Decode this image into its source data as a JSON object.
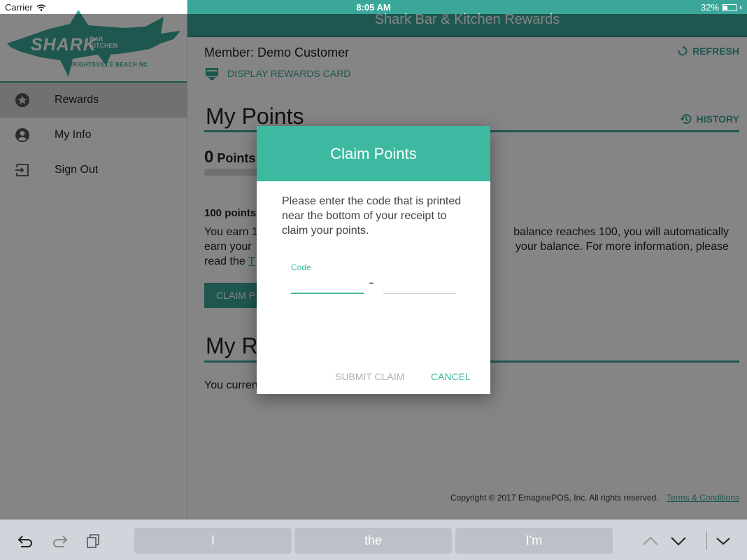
{
  "status_bar": {
    "carrier": "Carrier",
    "time": "8:05 AM",
    "battery": "32%",
    "battery_level": 0.32
  },
  "header": {
    "title": "Shark Bar & Kitchen Rewards"
  },
  "logo": {
    "name": "SHARK",
    "small_line1": "BAR",
    "small_line2": "KITCHEN",
    "location": "WRIGHTSVILLE BEACH NC"
  },
  "sidebar": {
    "items": [
      {
        "label": "Rewards",
        "icon": "star-icon",
        "active": true
      },
      {
        "label": "My Info",
        "icon": "person-icon",
        "active": false
      },
      {
        "label": "Sign Out",
        "icon": "exit-icon",
        "active": false
      }
    ]
  },
  "main": {
    "member_prefix": "Member:",
    "member_name": "Demo Customer",
    "refresh_label": "REFRESH",
    "display_card_label": "DISPLAY REWARDS CARD",
    "my_points_title": "My Points",
    "history_label": "HISTORY",
    "points_value": "0",
    "points_label": "Points",
    "progress": 0,
    "info_head": "100 points",
    "info_line1a": "You earn 1",
    "info_line1b": "balance reaches 100, you will automatically",
    "info_line2a": "earn your",
    "info_line2b": "your balance. For more information, please",
    "info_line3a": "read the",
    "info_link": "T",
    "claim_button": "CLAIM P",
    "my_rewards_title": "My R",
    "rewards_text": "You curren",
    "footer_copyright": "Copyright © 2017  EmaginePOS, Inc.   All rights reserved.",
    "footer_link": "Terms & Conditions"
  },
  "dialog": {
    "title": "Claim Points",
    "message": "Please enter the code that is printed near the bottom of your receipt to claim your points.",
    "code_label": "Code",
    "code_dash": "-",
    "code_part1": "",
    "code_part2": "",
    "submit_label": "SUBMIT CLAIM",
    "cancel_label": "CANCEL"
  },
  "keyboard_bar": {
    "suggestions": [
      "I",
      "the",
      "I'm"
    ]
  },
  "colors": {
    "accent": "#3aa79a",
    "dialog_header": "#3cb9a0",
    "overlay": "rgba(0,0,0,0.48)"
  }
}
